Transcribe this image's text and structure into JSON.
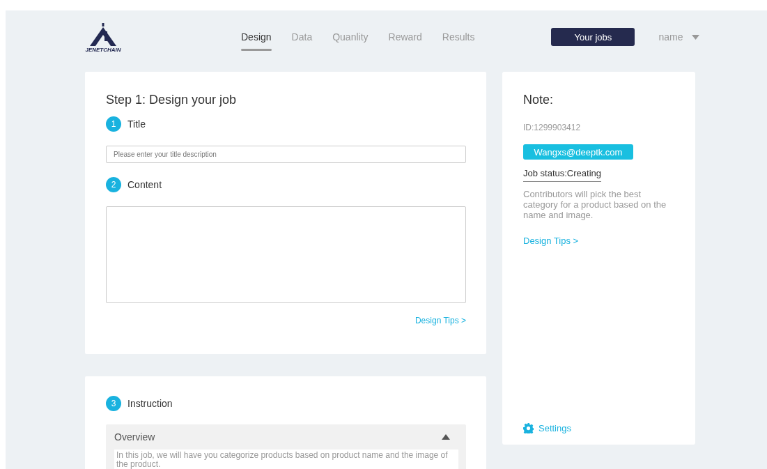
{
  "logo": {
    "text": "JENETCHAIN"
  },
  "nav": {
    "tabs": [
      {
        "label": "Design",
        "selected": true
      },
      {
        "label": "Data",
        "selected": false
      },
      {
        "label": "Quanlity",
        "selected": false
      },
      {
        "label": "Reward",
        "selected": false
      },
      {
        "label": "Results",
        "selected": false
      }
    ],
    "jobs_button": "Your jobs",
    "user": "name"
  },
  "design_card": {
    "heading": "Step 1: Design your job",
    "steps": [
      {
        "number": "1",
        "label": "Title",
        "kind": "input",
        "placeholder": "Please enter your title description"
      },
      {
        "number": "2",
        "label": "Content",
        "kind": "textarea"
      }
    ],
    "tips_link": "Design Tips >"
  },
  "instruction_card": {
    "number": "3",
    "label": "Instruction",
    "accordion": {
      "title": "Overview",
      "expanded": true,
      "text": "In this job, we will have you categorize products based on product name and the image of the product."
    }
  },
  "note": {
    "heading": "Note:",
    "id": "ID:1299903412",
    "email": "Wangxs@deeptk.com",
    "status": "Job status:Creating",
    "description": "Contributors will pick the best category for a product based on the name and image.",
    "tips_link": "Design Tips >",
    "settings": "Settings"
  }
}
